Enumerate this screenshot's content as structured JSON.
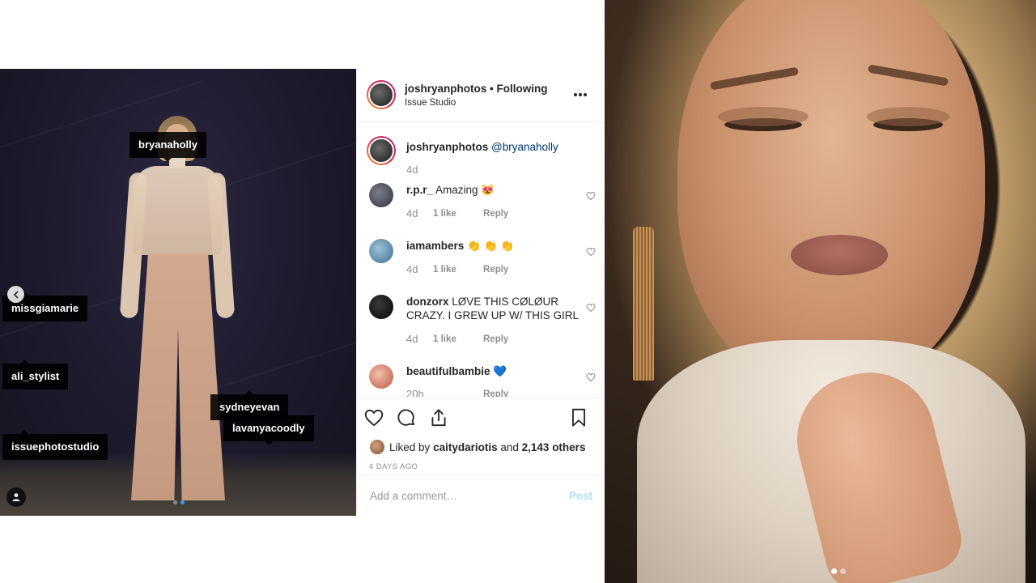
{
  "left_photo": {
    "tags": [
      {
        "name": "tag-bryanaholly",
        "label": "bryanaholly"
      },
      {
        "name": "tag-missgiamarie",
        "label": "missgiamarie"
      },
      {
        "name": "tag-ali-stylist",
        "label": "ali_stylist"
      },
      {
        "name": "tag-sydneyevan",
        "label": "sydneyevan"
      },
      {
        "name": "tag-lavanyacoodly",
        "label": "lavanyacoodly"
      },
      {
        "name": "tag-issuephotostudio",
        "label": "issuephotostudio"
      }
    ],
    "carousel": {
      "count": 2,
      "active": 1
    }
  },
  "post": {
    "username": "joshryanphotos",
    "separator": "•",
    "follow_status": "Following",
    "location": "Issue Studio",
    "caption": {
      "username": "joshryanphotos",
      "mention": "@bryanaholly",
      "time": "4d"
    },
    "comments": [
      {
        "username": "r.p.r_",
        "text": "Amazing 😻",
        "time": "4d",
        "likes": "1 like",
        "reply": "Reply",
        "avatar_color": "#3b3b44"
      },
      {
        "username": "iamambers",
        "text": "👏 👏 👏",
        "time": "4d",
        "likes": "1 like",
        "reply": "Reply",
        "avatar_color": "#4f86a8"
      },
      {
        "username": "donzorx",
        "text": "LØVE THIS CØLØUR CRAZY. I GREW UP W/ THIS GIRL",
        "time": "4d",
        "likes": "1 like",
        "reply": "Reply",
        "avatar_color": "#1a1a1a"
      },
      {
        "username": "beautifulbambie",
        "text": "💙",
        "time": "20h",
        "likes": "",
        "reply": "Reply",
        "avatar_color": "#d98b7a"
      }
    ],
    "likes": {
      "prefix": "Liked by",
      "user": "caitydariotis",
      "conj": "and",
      "others": "2,143 others"
    },
    "time_ago": "4 DAYS AGO",
    "add_comment": {
      "placeholder": "Add a comment…",
      "post_label": "Post"
    }
  },
  "right_photo": {
    "carousel": {
      "count": 2,
      "active": 0
    }
  },
  "colors": {
    "accent": "#3897f0",
    "mention": "#003569",
    "muted": "#8e8e8e",
    "post_disabled": "#b2dffc"
  }
}
